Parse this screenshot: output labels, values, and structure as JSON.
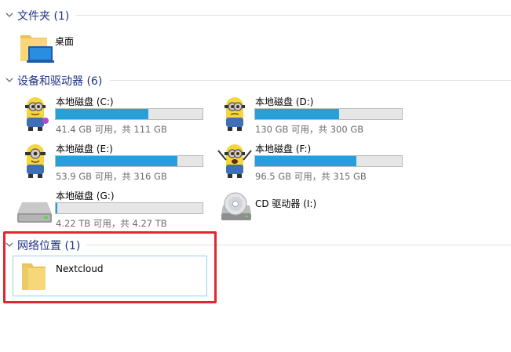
{
  "groups": {
    "folders": {
      "title": "文件夹 (1)"
    },
    "drives": {
      "title": "设备和驱动器 (6)"
    },
    "network": {
      "title": "网络位置 (1)"
    }
  },
  "folders": [
    {
      "name": "桌面",
      "icon": "desktop-folder-icon"
    }
  ],
  "drives": [
    {
      "name": "本地磁盘 (C:)",
      "capacity": "41.4 GB 可用，共 111 GB",
      "used_fraction": 0.63,
      "icon": "minion-drive-icon"
    },
    {
      "name": "本地磁盘 (D:)",
      "capacity": "130 GB 可用，共 300 GB",
      "used_fraction": 0.57,
      "icon": "minion-drive-icon"
    },
    {
      "name": "本地磁盘 (E:)",
      "capacity": "53.9 GB 可用，共 316 GB",
      "used_fraction": 0.83,
      "icon": "minion-drive-icon"
    },
    {
      "name": "本地磁盘 (F:)",
      "capacity": "96.5 GB 可用，共 315 GB",
      "used_fraction": 0.69,
      "icon": "minion-drive-icon"
    },
    {
      "name": "本地磁盘 (G:)",
      "capacity": "4.22 TB 可用，共 4.27 TB",
      "used_fraction": 0.01,
      "icon": "hard-disk-icon"
    },
    {
      "name": "CD 驱动器 (I:)",
      "icon": "cd-drive-icon"
    }
  ],
  "network": [
    {
      "name": "Nextcloud",
      "icon": "folder-icon"
    }
  ],
  "colors": {
    "header_text": "#1e3287",
    "usage_bar_fill": "#26a0da",
    "highlight_border": "#e0262e",
    "selection_border": "#99d1ef"
  }
}
